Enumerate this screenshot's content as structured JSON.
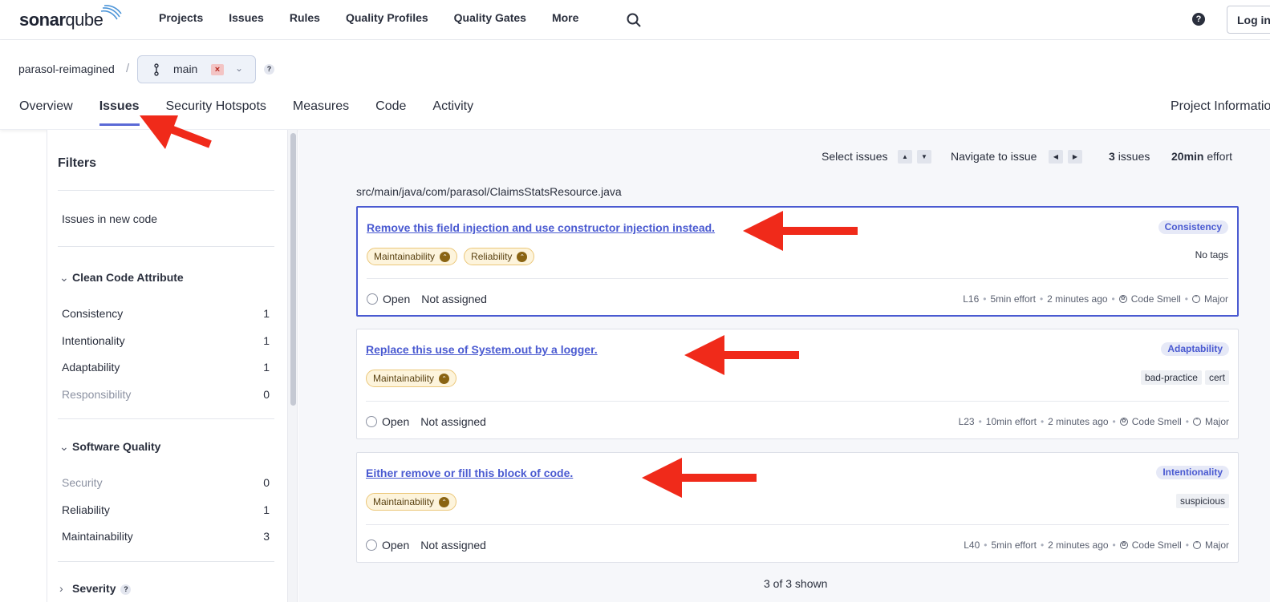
{
  "header": {
    "logo_text_bold": "sonar",
    "logo_text_light": "qube",
    "nav": [
      "Projects",
      "Issues",
      "Rules",
      "Quality Profiles",
      "Quality Gates",
      "More"
    ],
    "help_glyph": "?",
    "login_label": "Log in"
  },
  "project": {
    "name": "parasol-reimagined",
    "separator": "/",
    "branch": "main",
    "branch_clear": "×",
    "branch_help": "?",
    "tabs": [
      "Overview",
      "Issues",
      "Security Hotspots",
      "Measures",
      "Code",
      "Activity"
    ],
    "active_tab": "Issues",
    "info_label": "Project Information"
  },
  "filters": {
    "title": "Filters",
    "new_code": "Issues in new code",
    "clean_code": {
      "label": "Clean Code Attribute",
      "items": [
        {
          "label": "Consistency",
          "count": "1"
        },
        {
          "label": "Intentionality",
          "count": "1"
        },
        {
          "label": "Adaptability",
          "count": "1"
        },
        {
          "label": "Responsibility",
          "count": "0"
        }
      ]
    },
    "software_quality": {
      "label": "Software Quality",
      "items": [
        {
          "label": "Security",
          "count": "0"
        },
        {
          "label": "Reliability",
          "count": "1"
        },
        {
          "label": "Maintainability",
          "count": "3"
        }
      ]
    },
    "severity": {
      "label": "Severity",
      "help": "?"
    }
  },
  "toolbar": {
    "select_label": "Select issues",
    "navigate_label": "Navigate to issue",
    "issues_count": "3",
    "issues_suffix": "issues",
    "effort_value": "20min",
    "effort_suffix": "effort"
  },
  "file_path": "src/main/java/com/parasol/ClaimsStatsResource.java",
  "issues": [
    {
      "title": "Remove this field injection and use constructor injection instead.",
      "attribute": "Consistency",
      "qualities": [
        "Maintainability",
        "Reliability"
      ],
      "tags_text": "No tags",
      "tags": [],
      "status": "Open",
      "assignee": "Not assigned",
      "line": "L16",
      "effort": "5min effort",
      "age": "2 minutes ago",
      "type": "Code Smell",
      "severity": "Major"
    },
    {
      "title": "Replace this use of System.out by a logger.",
      "attribute": "Adaptability",
      "qualities": [
        "Maintainability"
      ],
      "tags_text": "",
      "tags": [
        "bad-practice",
        "cert"
      ],
      "status": "Open",
      "assignee": "Not assigned",
      "line": "L23",
      "effort": "10min effort",
      "age": "2 minutes ago",
      "type": "Code Smell",
      "severity": "Major"
    },
    {
      "title": "Either remove or fill this block of code.",
      "attribute": "Intentionality",
      "qualities": [
        "Maintainability"
      ],
      "tags_text": "",
      "tags": [
        "suspicious"
      ],
      "status": "Open",
      "assignee": "Not assigned",
      "line": "L40",
      "effort": "5min effort",
      "age": "2 minutes ago",
      "type": "Code Smell",
      "severity": "Major"
    }
  ],
  "shown_text": "3 of 3 shown",
  "colors": {
    "accent": "#4a5ad1",
    "annotation_arrow": "#f02a1a",
    "quality_badge": "#fdf4dc"
  }
}
